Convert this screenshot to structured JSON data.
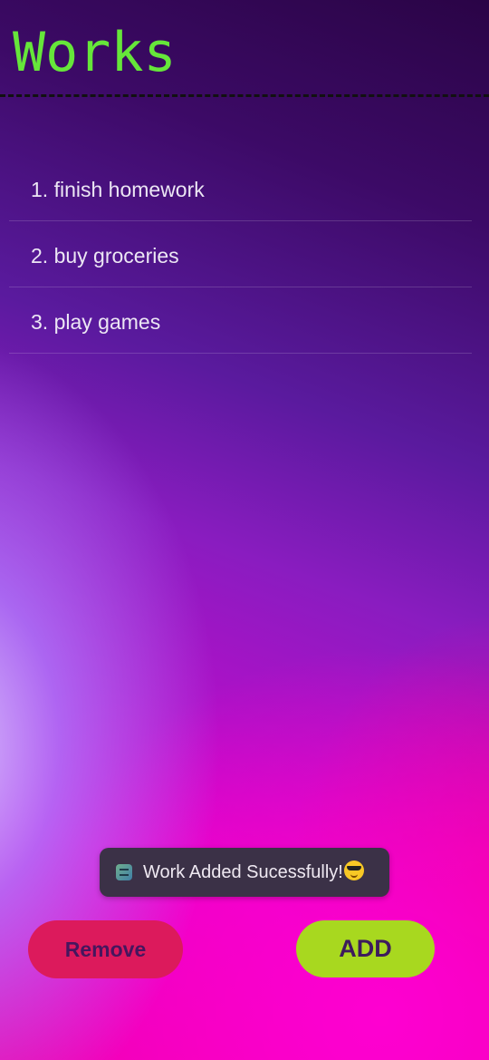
{
  "header": {
    "title": "Works"
  },
  "works": [
    {
      "text": "1. finish homework"
    },
    {
      "text": "2. buy groceries"
    },
    {
      "text": "3. play games"
    }
  ],
  "toast": {
    "message": "Work Added Sucessfully!",
    "emoji_icon": "smiling-face-with-sunglasses",
    "app_icon": "checklist-app-icon"
  },
  "buttons": {
    "remove_label": "Remove",
    "add_label": "ADD"
  },
  "colors": {
    "title": "#66e63a",
    "remove_button": "#dc1a5c",
    "add_button": "#a8d81f",
    "toast_background": "#3b3147"
  }
}
